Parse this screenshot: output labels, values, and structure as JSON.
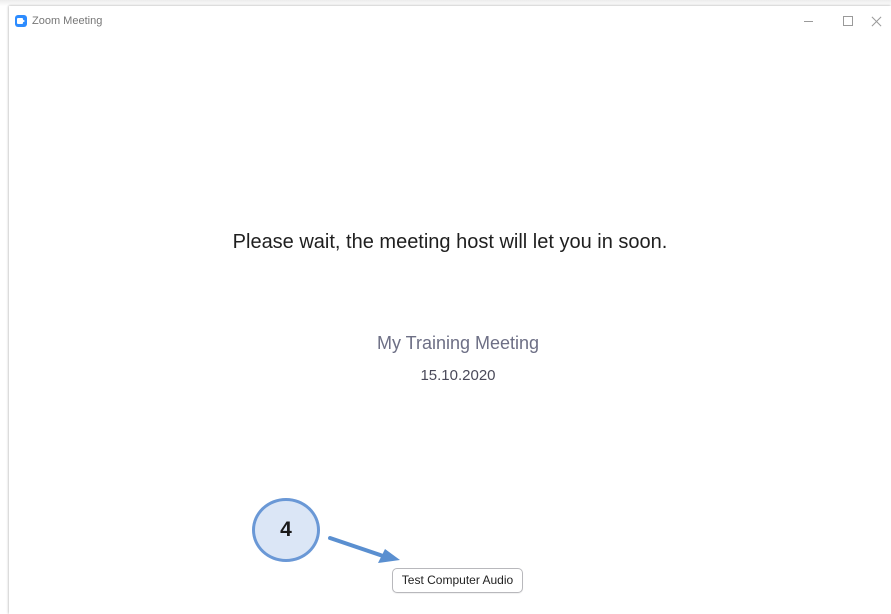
{
  "window": {
    "title": "Zoom Meeting",
    "app_icon": "zoom-camera-icon",
    "controls": [
      "minimize-icon",
      "maximize-icon",
      "close-icon"
    ]
  },
  "main": {
    "wait_message": "Please wait, the meeting host will let you in soon.",
    "meeting_name": "My Training Meeting",
    "meeting_date": "15.10.2020",
    "test_audio_label": "Test Computer Audio"
  },
  "annotation": {
    "step_number": "4",
    "arrow_icon": "arrow-right-icon"
  },
  "colors": {
    "app_accent": "#2D8CFF",
    "annotation_fill": "#dbe6f6",
    "annotation_stroke": "#6a98d6",
    "meeting_name_text": "#6d6f85"
  }
}
